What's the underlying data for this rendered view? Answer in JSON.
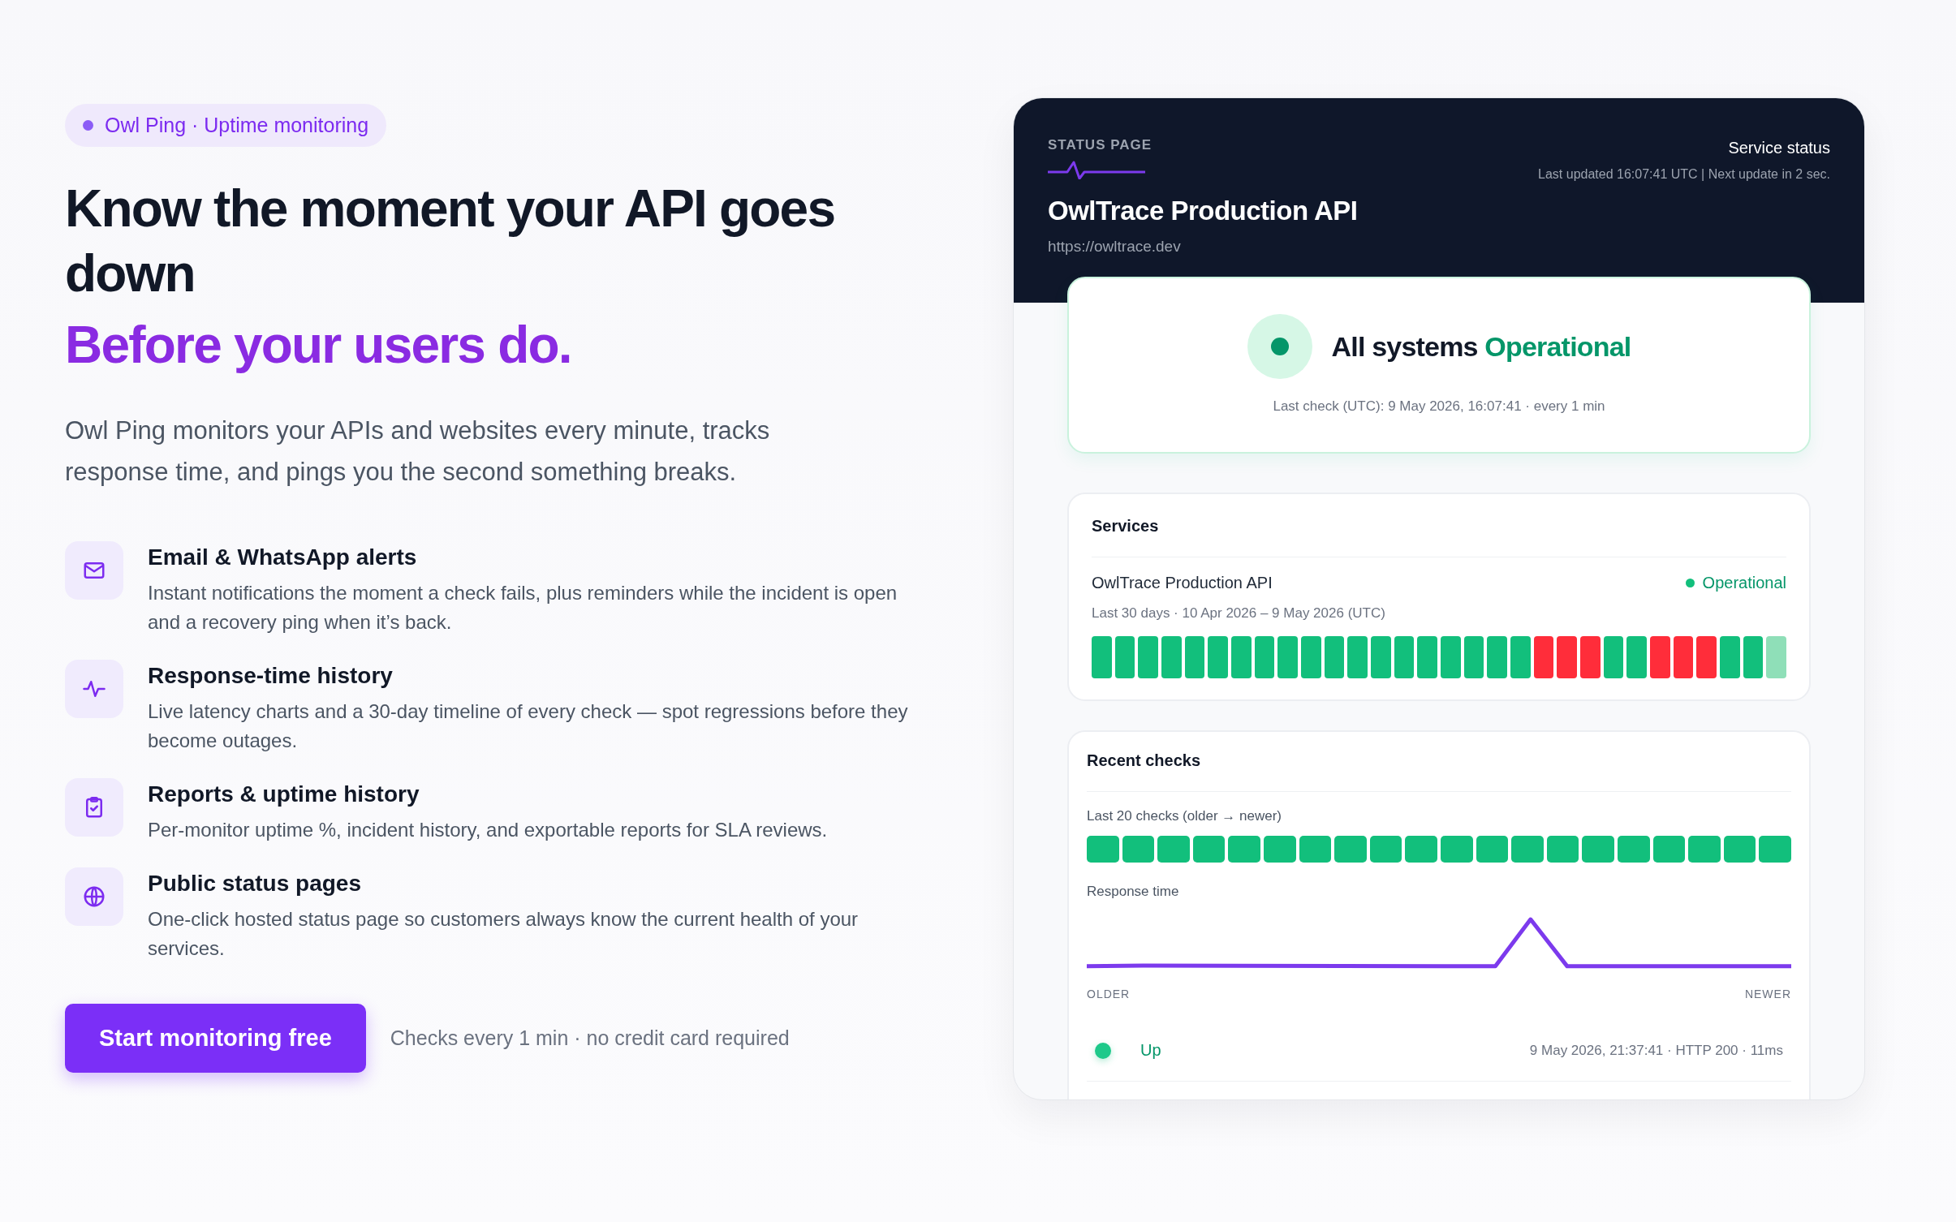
{
  "badge": {
    "label": "Owl Ping · Uptime monitoring"
  },
  "headline": "Know the moment your API goes down",
  "headline_accent": "Before your users do.",
  "intro": "Owl Ping monitors your APIs and websites every minute, tracks response time, and pings you the second something breaks.",
  "features": [
    {
      "title": "Email & WhatsApp alerts",
      "description": "Instant notifications the moment a check fails, plus reminders while the incident is open and a recovery ping when it’s back."
    },
    {
      "title": "Response-time history",
      "description": "Live latency charts and a 30-day timeline of every check — spot regressions before they become outages."
    },
    {
      "title": "Reports & uptime history",
      "description": "Per-monitor uptime %, incident history, and exportable reports for SLA reviews."
    },
    {
      "title": "Public status pages",
      "description": "One-click hosted status page so customers always know the current health of your services."
    }
  ],
  "cta": {
    "button": "Start monitoring free",
    "note": "Checks every 1 min · no credit card required"
  },
  "status_card": {
    "header": {
      "label": "STATUS PAGE",
      "title": "OwlTrace Production API",
      "url": "https://owltrace.dev",
      "right_title": "Service status",
      "updated": "Last updated 16:07:41 UTC | Next update in 2 sec."
    },
    "overall": {
      "label": "All systems",
      "status": "Operational",
      "color": "#059669",
      "last_check": "Last check (UTC): 9 May 2026, 16:07:41 · every 1 min"
    },
    "services": {
      "title": "Services",
      "items": [
        {
          "name": "OwlTrace Production API",
          "status": "Operational",
          "color": "#12bf7c",
          "range": "Last 30 days · 10 Apr 2026 – 9 May 2026 (UTC)",
          "days": [
            {
              "color": "#12bf7c"
            },
            {
              "color": "#12bf7c"
            },
            {
              "color": "#12bf7c"
            },
            {
              "color": "#12bf7c"
            },
            {
              "color": "#12bf7c"
            },
            {
              "color": "#12bf7c"
            },
            {
              "color": "#12bf7c"
            },
            {
              "color": "#12bf7c"
            },
            {
              "color": "#12bf7c"
            },
            {
              "color": "#12bf7c"
            },
            {
              "color": "#12bf7c"
            },
            {
              "color": "#12bf7c"
            },
            {
              "color": "#12bf7c"
            },
            {
              "color": "#12bf7c"
            },
            {
              "color": "#12bf7c"
            },
            {
              "color": "#12bf7c"
            },
            {
              "color": "#12bf7c"
            },
            {
              "color": "#12bf7c"
            },
            {
              "color": "#12bf7c"
            },
            {
              "color": "#ff2d3a"
            },
            {
              "color": "#ff2d3a"
            },
            {
              "color": "#ff2d3a"
            },
            {
              "color": "#12bf7c"
            },
            {
              "color": "#12bf7c"
            },
            {
              "color": "#ff2d3a"
            },
            {
              "color": "#ff2d3a"
            },
            {
              "color": "#ff2d3a"
            },
            {
              "color": "#12bf7c"
            },
            {
              "color": "#12bf7c"
            },
            {
              "color": "#8fdfb8"
            }
          ]
        }
      ]
    },
    "recent": {
      "title": "Recent checks",
      "strip_label": "Last 20 checks (older → newer)",
      "checks": [
        {
          "color": "#12bf7c"
        },
        {
          "color": "#12bf7c"
        },
        {
          "color": "#12bf7c"
        },
        {
          "color": "#12bf7c"
        },
        {
          "color": "#12bf7c"
        },
        {
          "color": "#12bf7c"
        },
        {
          "color": "#12bf7c"
        },
        {
          "color": "#12bf7c"
        },
        {
          "color": "#12bf7c"
        },
        {
          "color": "#12bf7c"
        },
        {
          "color": "#12bf7c"
        },
        {
          "color": "#12bf7c"
        },
        {
          "color": "#12bf7c"
        },
        {
          "color": "#12bf7c"
        },
        {
          "color": "#12bf7c"
        },
        {
          "color": "#12bf7c"
        },
        {
          "color": "#12bf7c"
        },
        {
          "color": "#12bf7c"
        },
        {
          "color": "#12bf7c"
        },
        {
          "color": "#12bf7c"
        }
      ],
      "chart_label": "Response time",
      "axis_start": "OLDER",
      "axis_end": "NEWER",
      "rows": [
        {
          "color": "#1ec98a",
          "label": "Up",
          "detail": "9 May 2026, 21:37:41 · HTTP 200 · 11ms"
        }
      ]
    }
  }
}
